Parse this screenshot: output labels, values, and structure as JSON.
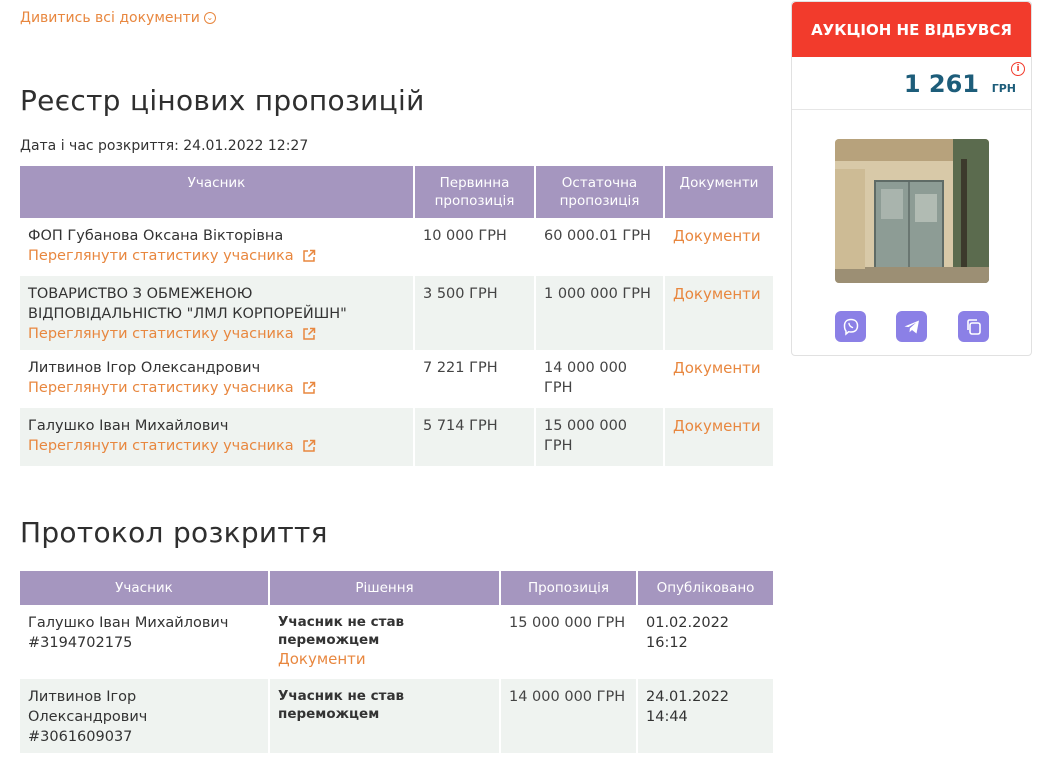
{
  "top_link": {
    "label": "Дивитись всі документи"
  },
  "registry": {
    "title": "Реєстр цінових пропозицій",
    "open_date": "Дата і час розкриття: 24.01.2022 12:27",
    "headers": {
      "participant": "Учасник",
      "initial": "Первинна пропозиція",
      "final": "Остаточна пропозиція",
      "docs": "Документи"
    },
    "rows": [
      {
        "name": "ФОП Губанова Оксана Вікторівна",
        "stat": "Переглянути статистику учасника",
        "initial": "10 000 ГРН",
        "final": "60 000.01 ГРН",
        "docs": "Документи"
      },
      {
        "name": "ТОВАРИСТВО З ОБМЕЖЕНОЮ ВІДПОВІДАЛЬНІСТЮ \"ЛМЛ КОРПОРЕЙШН\"",
        "stat": "Переглянути статистику учасника",
        "initial": "3 500 ГРН",
        "final": "1 000 000 ГРН",
        "docs": "Документи"
      },
      {
        "name": "Литвинов Ігор Олександрович",
        "stat": "Переглянути статистику учасника",
        "initial": "7 221 ГРН",
        "final": "14 000 000 ГРН",
        "docs": "Документи"
      },
      {
        "name": "Галушко Іван Михайлович",
        "stat": "Переглянути статистику учасника",
        "initial": "5 714 ГРН",
        "final": "15 000 000 ГРН",
        "docs": "Документи"
      }
    ]
  },
  "protocol": {
    "title": "Протокол розкриття",
    "headers": {
      "participant": "Учасник",
      "decision": "Рішення",
      "offer": "Пропозиція",
      "published": "Опубліковано"
    },
    "rows": [
      {
        "name": "Галушко Іван Михайлович",
        "id": "#3194702175",
        "decision": "Учасник не став переможцем",
        "docs": "Документи",
        "offer": "15 000 000 ГРН",
        "date": "01.02.2022",
        "time": "16:12"
      },
      {
        "name": "Литвинов Ігор Олександрович",
        "id": "#3061609037",
        "decision": "Учасник не став переможцем",
        "offer": "14 000 000 ГРН",
        "date": "24.01.2022",
        "time": "14:44"
      }
    ]
  },
  "side": {
    "status": "АУКЦІОН НЕ ВІДБУВСЯ",
    "price": "1 261",
    "currency": "ГРН",
    "status_color": "#f23b2c",
    "price_color": "#1d5d7a",
    "share_icons": [
      "viber-icon",
      "telegram-icon",
      "copy-icon"
    ]
  }
}
